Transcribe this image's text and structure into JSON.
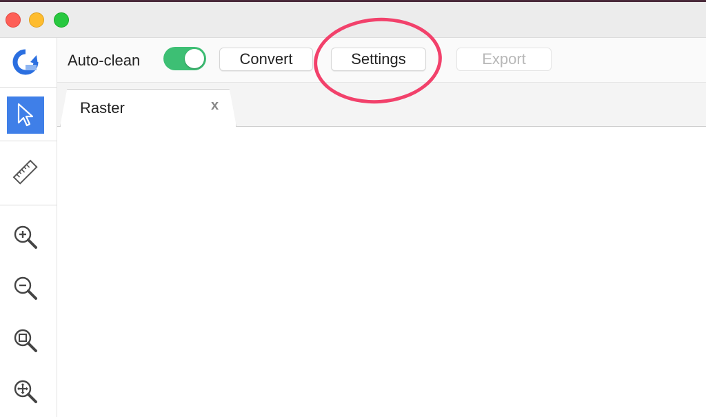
{
  "window": {
    "controls": [
      "close",
      "minimize",
      "maximize"
    ]
  },
  "sidebar": {
    "logo_icon": "app-logo-icon",
    "tools": [
      {
        "icon": "pointer-icon",
        "active": true
      },
      {
        "icon": "ruler-icon",
        "active": false
      },
      {
        "icon": "zoom-in-icon",
        "active": false
      },
      {
        "icon": "zoom-out-icon",
        "active": false
      },
      {
        "icon": "zoom-fit-icon",
        "active": false
      },
      {
        "icon": "pan-icon",
        "active": false
      }
    ]
  },
  "toolbar": {
    "autoclean_label": "Auto-clean",
    "autoclean_on": true,
    "convert_label": "Convert",
    "settings_label": "Settings",
    "export_label": "Export",
    "export_enabled": false
  },
  "tabs": [
    {
      "label": "Raster",
      "close_label": "x"
    }
  ],
  "colors": {
    "accent": "#3f7fe8",
    "toggle_on": "#3dbf74",
    "annotation": "#f2416b"
  }
}
